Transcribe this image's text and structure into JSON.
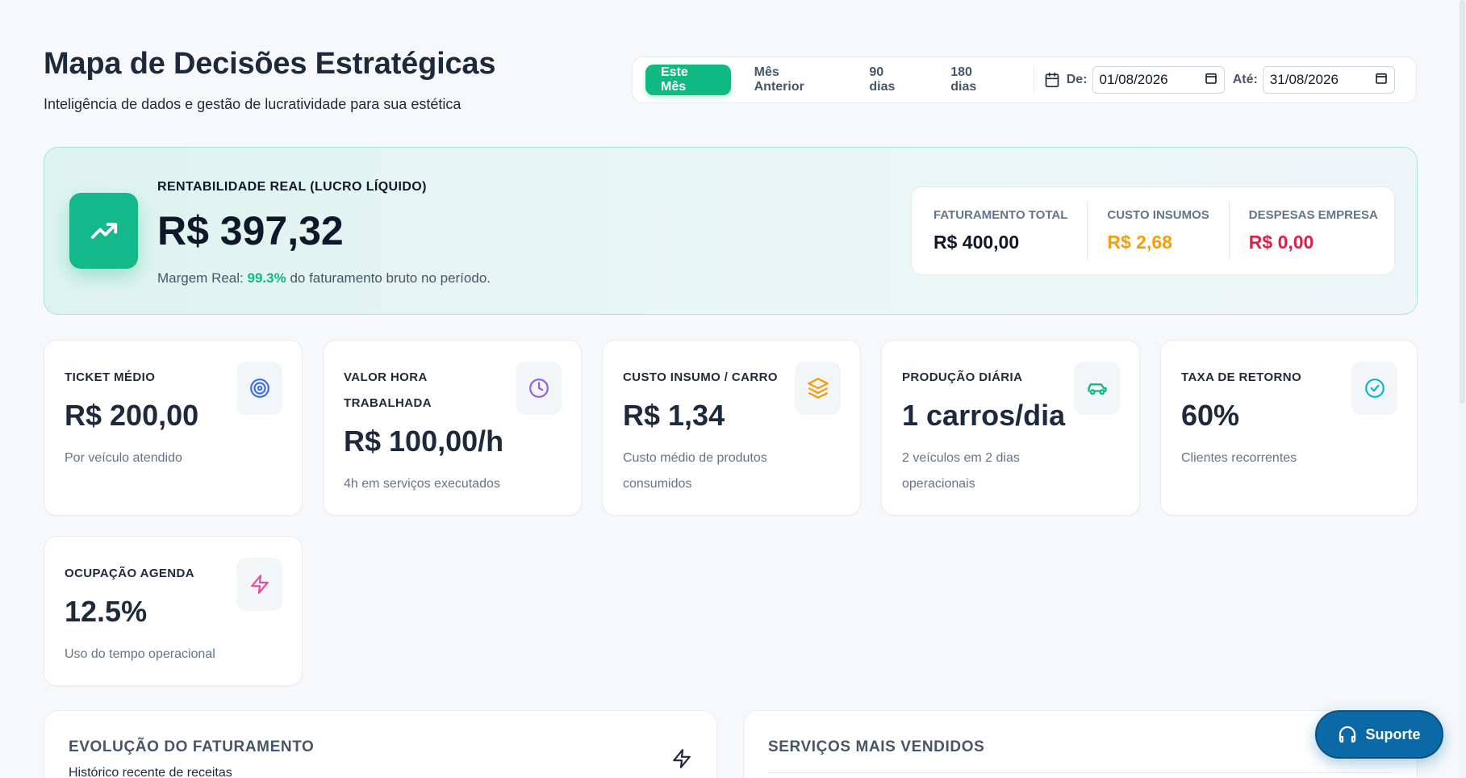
{
  "header": {
    "title": "Mapa de Decisões Estratégicas",
    "subtitle": "Inteligência de dados e gestão de lucratividade para sua estética"
  },
  "filters": {
    "periods": [
      "Este Mês",
      "Mês Anterior",
      "90 dias",
      "180 dias"
    ],
    "active_index": 0,
    "from_label": "De:",
    "from_value": "01/08/2026",
    "to_label": "Até:",
    "to_value": "31/08/2026"
  },
  "hero": {
    "label": "RENTABILIDADE REAL (LUCRO LÍQUIDO)",
    "value": "R$ 397,32",
    "note_prefix": "Margem Real:",
    "note_pct": "99.3%",
    "note_suffix": "do faturamento bruto no período.",
    "stats": [
      {
        "label": "FATURAMENTO TOTAL",
        "value": "R$ 400,00",
        "color": "#0f172a"
      },
      {
        "label": "CUSTO INSUMOS",
        "value": "R$ 2,68",
        "color": "#f59e0b"
      },
      {
        "label": "DESPESAS EMPRESA",
        "value": "R$ 0,00",
        "color": "#e11d48"
      }
    ]
  },
  "kpis": [
    {
      "label": "TICKET MÉDIO",
      "value": "R$ 200,00",
      "sub": "Por veículo atendido",
      "icon": "target-icon",
      "icon_color": "#3b6cf6"
    },
    {
      "label": "VALOR HORA TRABALHADA",
      "value": "R$ 100,00/h",
      "sub": "4h em serviços executados",
      "icon": "clock-icon",
      "icon_color": "#8b5cf6"
    },
    {
      "label": "CUSTO INSUMO / CARRO",
      "value": "R$ 1,34",
      "sub": "Custo médio de produtos consumidos",
      "icon": "layers-icon",
      "icon_color": "#f59e0b"
    },
    {
      "label": "PRODUÇÃO DIÁRIA",
      "value": "1 carros/dia",
      "sub": "2 veículos em 2 dias operacionais",
      "icon": "car-icon",
      "icon_color": "#10b981"
    },
    {
      "label": "TAXA DE RETORNO",
      "value": "60%",
      "sub": "Clientes recorrentes",
      "icon": "check-circle-icon",
      "icon_color": "#06b6d4"
    },
    {
      "label": "OCUPAÇÃO AGENDA",
      "value": "12.5%",
      "sub": "Uso do tempo operacional",
      "icon": "bolt-icon",
      "icon_color": "#ec4899"
    }
  ],
  "panels": {
    "revenue_title": "EVOLUÇÃO DO FATURAMENTO",
    "revenue_sub": "Histórico recente de receitas",
    "services_title": "SERVIÇOS MAIS VENDIDOS"
  },
  "support": {
    "label": "Suporte"
  }
}
